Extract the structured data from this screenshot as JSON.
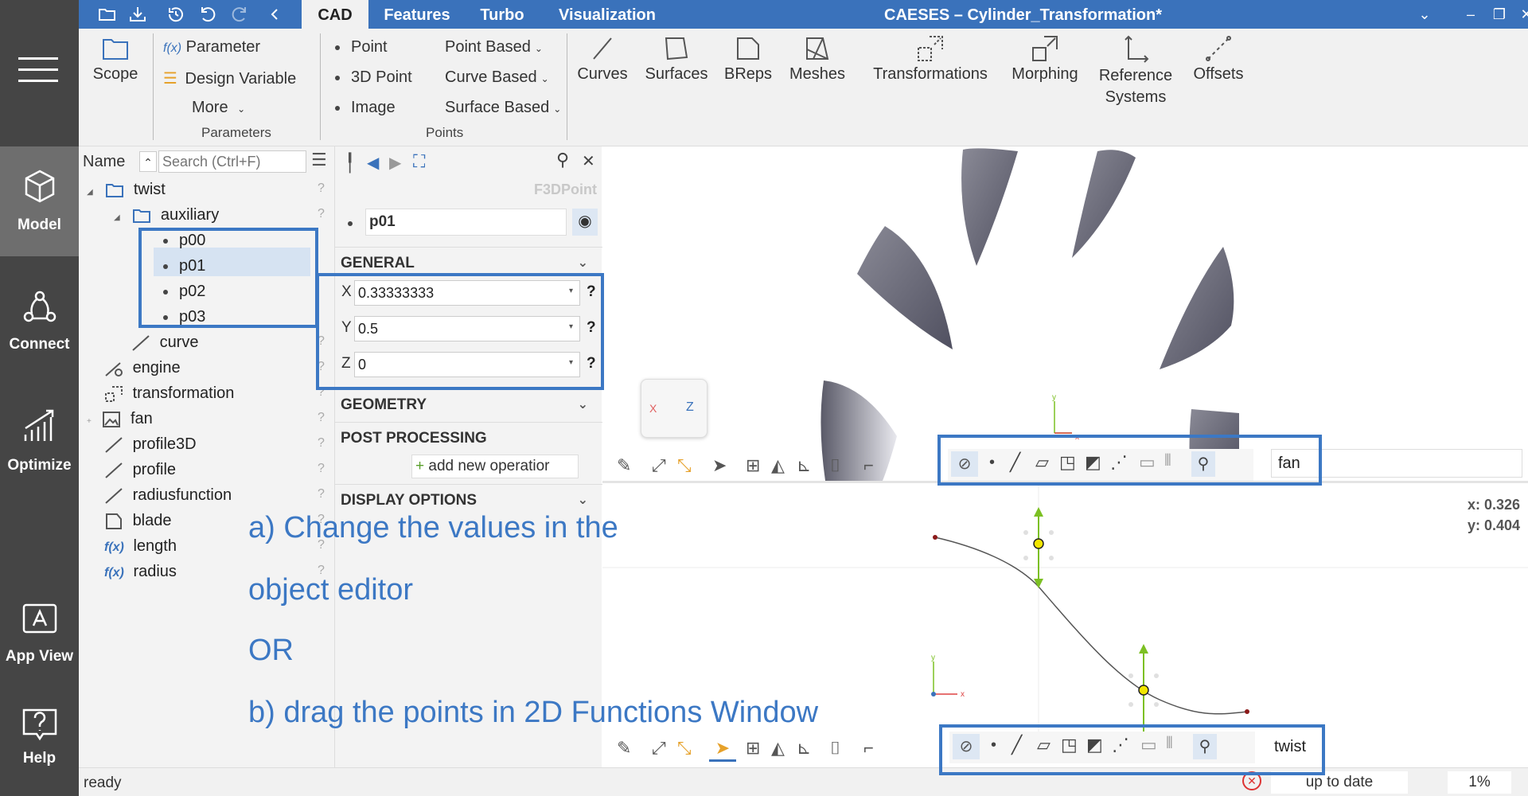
{
  "titlebar": {
    "tabs": [
      "CAD",
      "Features",
      "Turbo",
      "Visualization"
    ],
    "app_title": "CAESES  –  Cylinder_Transformation*"
  },
  "sidebar": {
    "items": [
      {
        "label": "Model",
        "icon": "cube-icon"
      },
      {
        "label": "Connect",
        "icon": "connect-icon"
      },
      {
        "label": "Optimize",
        "icon": "optimize-icon"
      },
      {
        "label": "App View",
        "icon": "app-view-icon"
      },
      {
        "label": "Help",
        "icon": "help-icon"
      }
    ]
  },
  "ribbon": {
    "scope": "Scope",
    "parameter": "Parameter",
    "parameter_prefix": "f(x)",
    "design_variable": "Design Variable",
    "more": "More",
    "group_parameters": "Parameters",
    "point": "Point",
    "point_3d": "3D Point",
    "image": "Image",
    "point_based": "Point Based",
    "curve_based": "Curve Based",
    "surface_based": "Surface Based",
    "group_points": "Points",
    "curves": "Curves",
    "surfaces": "Surfaces",
    "breps": "BReps",
    "meshes": "Meshes",
    "transformations": "Transformations",
    "morphing": "Morphing",
    "reference_systems_1": "Reference",
    "reference_systems_2": "Systems",
    "offsets": "Offsets"
  },
  "tree": {
    "column_name": "Name",
    "search_placeholder": "Search (Ctrl+F)",
    "items": [
      {
        "label": "twist"
      },
      {
        "label": "auxiliary"
      },
      {
        "label": "p00"
      },
      {
        "label": "p01"
      },
      {
        "label": "p02"
      },
      {
        "label": "p03"
      },
      {
        "label": "curve"
      },
      {
        "label": "engine"
      },
      {
        "label": "transformation"
      },
      {
        "label": "fan"
      },
      {
        "label": "profile3D"
      },
      {
        "label": "profile"
      },
      {
        "label": "radiusfunction"
      },
      {
        "label": "blade"
      },
      {
        "label": "length"
      },
      {
        "label": "radius"
      }
    ],
    "fx_prefix": "f(x)",
    "help_mark": "?"
  },
  "editor": {
    "type_label": "F3DPoint",
    "name_value": "p01",
    "section_general": "GENERAL",
    "x_label": "X",
    "x_value": "0.33333333",
    "y_label": "Y",
    "y_value": "0.5",
    "z_label": "Z",
    "z_value": "0",
    "help_mark": "?",
    "section_geometry": "GEOMETRY",
    "section_post": "POST PROCESSING",
    "add_operation": "add new operatior",
    "section_display": "DISPLAY OPTIONS"
  },
  "viewport3d": {
    "filter_value": "fan",
    "cube_x": "X",
    "cube_z": "Z",
    "axis_y": "y",
    "axis_x": "x"
  },
  "viewport2d": {
    "coord_x": "x: 0.326",
    "coord_y": "y: 0.404",
    "filter_value": "twist",
    "axis_y": "y",
    "axis_x": "x"
  },
  "status": {
    "text": "ready",
    "update_state": "up to date",
    "progress": "1%"
  },
  "annotation": {
    "line1": "a) Change the values in the",
    "line2": "object editor",
    "line3": "OR",
    "line4": "b) drag the points in 2D Functions Window"
  },
  "colors": {
    "titlebar": "#3a72bb",
    "sidebar": "#454545",
    "annotation": "#3c78c4",
    "selection": "#d6e3f2",
    "handle_arrow": "#7cc023",
    "handle_point": "#f2e600"
  }
}
